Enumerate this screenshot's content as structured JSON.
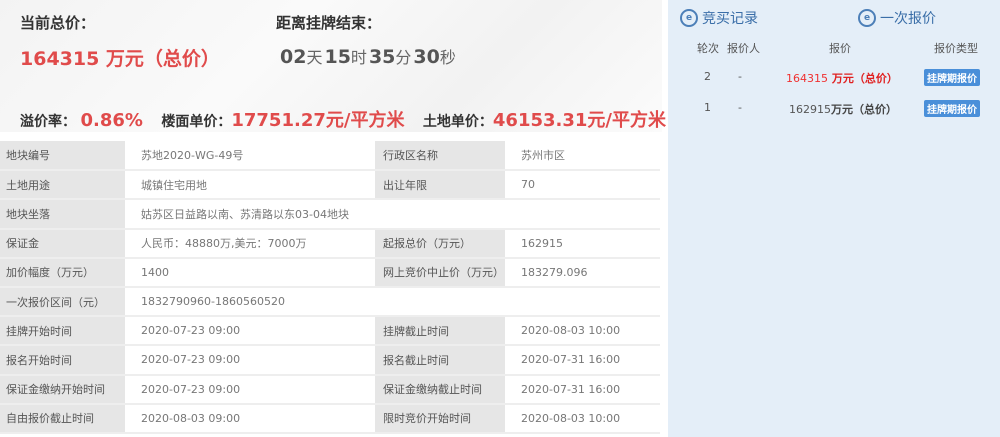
{
  "summary": {
    "current_label": "当前总价：",
    "current_value": "164315 万元（总价）",
    "countdown_label": "距离挂牌结束：",
    "countdown": {
      "days": "02",
      "days_unit": "天",
      "hours": "15",
      "hours_unit": "时",
      "minutes": "35",
      "minutes_unit": "分",
      "seconds": "30",
      "seconds_unit": "秒"
    },
    "premium_label": "溢价率：",
    "premium_value": "0.86%",
    "floor_label": "楼面单价：",
    "floor_value": "17751.27元/平方米",
    "land_label": "土地单价：",
    "land_value": "46153.31元/平方米"
  },
  "details": [
    {
      "k": "地块编号",
      "v": "苏地2020-WG-49号",
      "k2": "行政区名称",
      "v2": "苏州市区"
    },
    {
      "k": "土地用途",
      "v": "城镇住宅用地",
      "k2": "出让年限",
      "v2": "70"
    },
    {
      "k": "地块坐落",
      "v": "姑苏区日益路以南、苏清路以东03-04地块"
    },
    {
      "k": "保证金",
      "v": "人民币：48880万,美元：7000万",
      "k2": "起报总价（万元）",
      "v2": "162915"
    },
    {
      "k": "加价幅度（万元）",
      "v": "1400",
      "k2": "网上竞价中止价（万元）",
      "v2": "183279.096"
    },
    {
      "k": "一次报价区间（元）",
      "v": "1832790960-1860560520"
    },
    {
      "k": "挂牌开始时间",
      "v": "2020-07-23 09:00",
      "k2": "挂牌截止时间",
      "v2": "2020-08-03 10:00"
    },
    {
      "k": "报名开始时间",
      "v": "2020-07-23 09:00",
      "k2": "报名截止时间",
      "v2": "2020-07-31 16:00"
    },
    {
      "k": "保证金缴纳开始时间",
      "v": "2020-07-23 09:00",
      "k2": "保证金缴纳截止时间",
      "v2": "2020-07-31 16:00"
    },
    {
      "k": "自由报价截止时间",
      "v": "2020-08-03 09:00",
      "k2": "限时竞价开始时间",
      "v2": "2020-08-03 10:00"
    }
  ],
  "records": {
    "tab1": "竞买记录",
    "tab2": "一次报价",
    "headers": [
      "轮次",
      "报价人",
      "报价",
      "报价类型"
    ],
    "rows": [
      {
        "round": "2",
        "bidder": "-",
        "num": "164315",
        "unit": " 万元（总价）",
        "type": "挂牌期报价"
      },
      {
        "round": "1",
        "bidder": "-",
        "num": "162915",
        "unit": "万元（总价）",
        "type": "挂牌期报价"
      }
    ]
  }
}
